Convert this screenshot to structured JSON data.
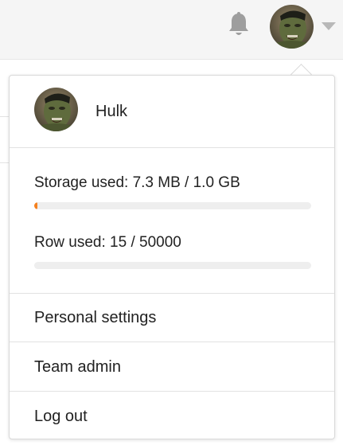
{
  "header": {
    "bell_icon": "bell-icon",
    "avatar_icon": "hulk-avatar",
    "caret_icon": "chevron-down-icon"
  },
  "user": {
    "name": "Hulk"
  },
  "usage": {
    "storage_label": "Storage used: 7.3 MB / 1.0 GB",
    "storage_fraction": 0.0073,
    "row_label": "Row used: 15 / 50000",
    "row_fraction": 0.0003
  },
  "menu": {
    "items": [
      {
        "label": "Personal settings"
      },
      {
        "label": "Team admin"
      },
      {
        "label": "Log out"
      }
    ]
  },
  "colors": {
    "progress_fill": "#f5811f",
    "track": "#eeeeee"
  }
}
